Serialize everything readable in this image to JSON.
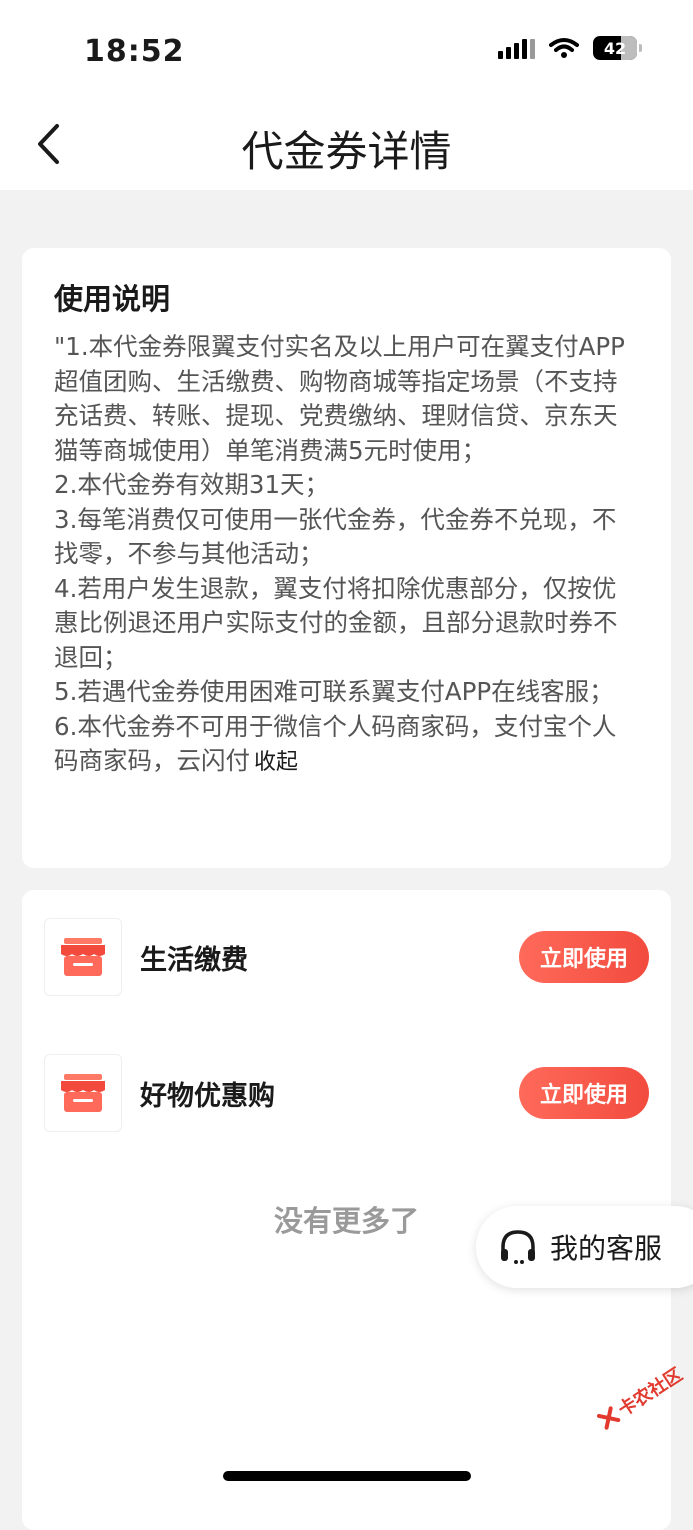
{
  "status": {
    "time": "18:52",
    "battery": "42"
  },
  "nav": {
    "title": "代金券详情"
  },
  "instructions": {
    "title": "使用说明",
    "lines": [
      "\"1.本代金券限翼支付实名及以上用户可在翼支付APP超值团购、生活缴费、购物商城等指定场景（不支持充话费、转账、提现、党费缴纳、理财信贷、京东天猫等商城使用）单笔消费满5元时使用；",
      "2.本代金券有效期31天；",
      "3.每笔消费仅可使用一张代金券，代金券不兑现，不找零，不参与其他活动；",
      "4.若用户发生退款，翼支付将扣除优惠部分，仅按优惠比例退还用户实际支付的金额，且部分退款时券不退回；",
      "5.若遇代金券使用困难可联系翼支付APP在线客服；",
      "6.本代金券不可用于微信个人码商家码，支付宝个人码商家码，云闪付"
    ],
    "collapse_label": "收起"
  },
  "scenes": [
    {
      "label": "生活缴费",
      "button": "立即使用",
      "icon": "shop-icon"
    },
    {
      "label": "好物优惠购",
      "button": "立即使用",
      "icon": "shop-icon"
    }
  ],
  "no_more": "没有更多了",
  "service": {
    "label": "我的客服",
    "icon": "headset-icon"
  },
  "watermark": "卡农社区",
  "colors": {
    "accent": "#f24b3e",
    "background": "#f2f2f2"
  }
}
